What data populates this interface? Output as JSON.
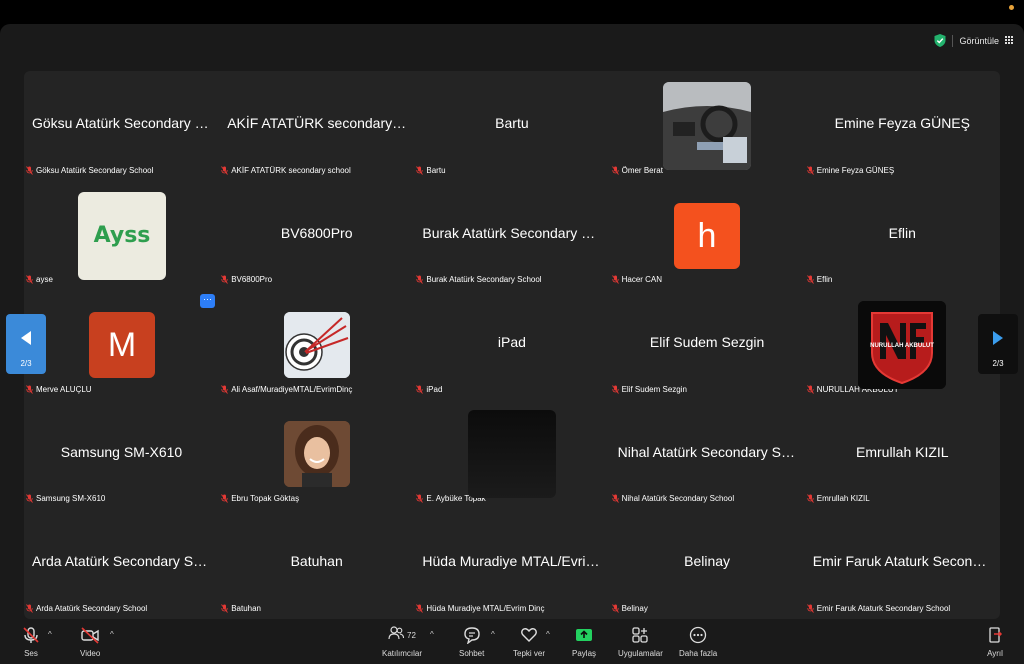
{
  "header": {
    "view_label": "Görüntüle"
  },
  "tiles": [
    {
      "big": "Göksu Atatürk Secondary S...",
      "name": "Göksu Atatürk Secondary School"
    },
    {
      "big": "AKİF ATATÜRK secondary s...",
      "name": "AKİF ATATÜRK secondary school"
    },
    {
      "big": "Bartu",
      "name": "Bartu"
    },
    {
      "big": "",
      "name": "Ömer Berat"
    },
    {
      "big": "Emine Feyza GÜNEŞ",
      "name": "Emine Feyza GÜNEŞ"
    },
    {
      "big": "",
      "name": "ayse"
    },
    {
      "big": "BV6800Pro",
      "name": "BV6800Pro"
    },
    {
      "big": "Burak Atatürk Secondary Sc...",
      "name": "Burak Atatürk Secondary School"
    },
    {
      "big": "",
      "name": "Hacer CAN"
    },
    {
      "big": "Eflin",
      "name": "Eflin"
    },
    {
      "big": "",
      "name": "Merve ALUÇLU"
    },
    {
      "big": "",
      "name": "Ali Asaf/MuradiyeMTAL/EvrimDinç"
    },
    {
      "big": "iPad",
      "name": "iPad"
    },
    {
      "big": "Elif Sudem Sezgin",
      "name": "Elif Sudem Sezgin"
    },
    {
      "big": "",
      "name": "NURULLAH AKBULUT"
    },
    {
      "big": "Samsung SM-X610",
      "name": "Samsung SM-X610"
    },
    {
      "big": "",
      "name": "Ebru Topak Göktaş"
    },
    {
      "big": "",
      "name": "E. Aybüke Topak"
    },
    {
      "big": "Nihal Atatürk Secondary Sc...",
      "name": "Nihal Atatürk Secondary School"
    },
    {
      "big": "Emrullah KIZIL",
      "name": "Emrullah KIZIL"
    },
    {
      "big": "Arda Atatürk Secondary Sch...",
      "name": "Arda Atatürk Secondary School"
    },
    {
      "big": "Batuhan",
      "name": "Batuhan"
    },
    {
      "big": "Hüda Muradiye MTAL/Evrim...",
      "name": "Hüda Muradiye MTAL/Evrim Dinç"
    },
    {
      "big": "Belinay",
      "name": "Belinay"
    },
    {
      "big": "Emir Faruk Ataturk Seconda...",
      "name": "Emir Faruk Ataturk Secondary School"
    }
  ],
  "avatars": {
    "ayse_text": "Ayss",
    "hacer_letter": "h",
    "merve_letter": "M",
    "nurullah_logo_text": "NURULLAH AKBULUT"
  },
  "colors": {
    "hacer": "#f4511e",
    "merve": "#c8401f",
    "accent_blue": "#2d7ef7",
    "share_green": "#23d160"
  },
  "pagination": {
    "left": "2/3",
    "right": "2/3"
  },
  "toolbar": {
    "audio": "Ses",
    "video": "Video",
    "participants": "Katılımcılar",
    "participants_count": "72",
    "chat": "Sohbet",
    "react": "Tepki ver",
    "share": "Paylaş",
    "apps": "Uygulamalar",
    "more": "Daha fazla",
    "leave": "Ayrıl"
  }
}
